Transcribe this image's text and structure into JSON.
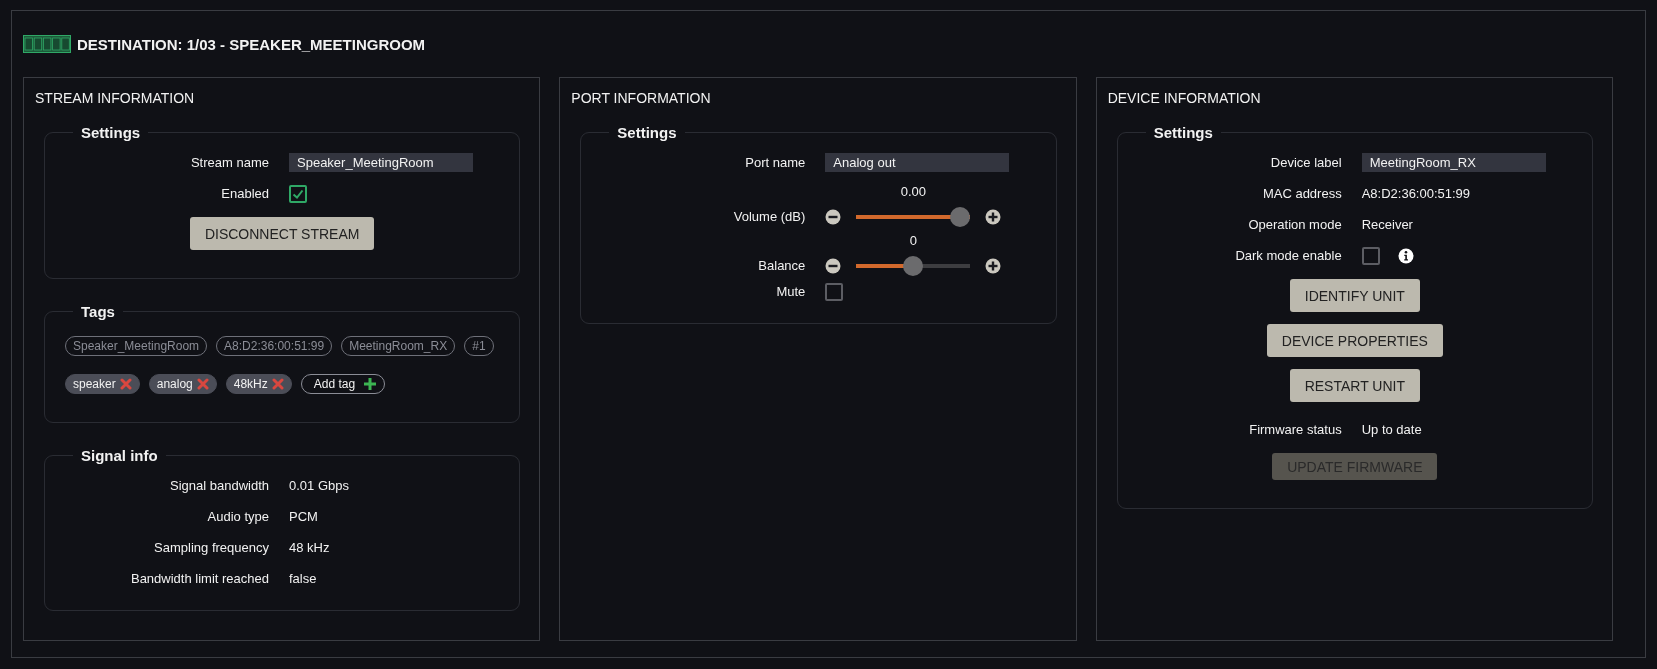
{
  "header": {
    "title": "DESTINATION: 1/03 - SPEAKER_MEETINGROOM"
  },
  "panels": [
    {
      "title": "STREAM INFORMATION",
      "groups": [
        {
          "title": "Settings",
          "kind": "form",
          "rows": [
            {
              "kind": "input",
              "label": "Stream name",
              "value": "Speaker_MeetingRoom"
            },
            {
              "kind": "checkbox",
              "label": "Enabled",
              "checked": true
            },
            {
              "kind": "button",
              "label": "DISCONNECT STREAM",
              "disabled": false
            }
          ]
        },
        {
          "title": "Tags",
          "kind": "tags",
          "tags": [
            {
              "label": "Speaker_MeetingRoom",
              "removable": false
            },
            {
              "label": "A8:D2:36:00:51:99",
              "removable": false
            },
            {
              "label": "MeetingRoom_RX",
              "removable": false
            },
            {
              "label": "#1",
              "removable": false
            },
            {
              "label": "speaker",
              "removable": true
            },
            {
              "label": "analog",
              "removable": true
            },
            {
              "label": "48kHz",
              "removable": true
            }
          ],
          "add_tag": "Add tag"
        },
        {
          "title": "Signal info",
          "kind": "form",
          "rows": [
            {
              "kind": "text",
              "label": "Signal bandwidth",
              "value": "0.01 Gbps"
            },
            {
              "kind": "text",
              "label": "Audio type",
              "value": "PCM"
            },
            {
              "kind": "text",
              "label": "Sampling frequency",
              "value": "48 kHz"
            },
            {
              "kind": "text",
              "label": "Bandwidth limit reached",
              "value": "false"
            }
          ]
        }
      ]
    },
    {
      "title": "PORT INFORMATION",
      "groups": [
        {
          "title": "Settings",
          "kind": "form",
          "rows": [
            {
              "kind": "input",
              "label": "Port name",
              "value": "Analog out"
            },
            {
              "kind": "slider",
              "label": "Volume (dB)",
              "reading": "0.00",
              "level": 1
            },
            {
              "kind": "slider",
              "label": "Balance",
              "reading": "0",
              "level": 0.5
            },
            {
              "kind": "checkbox",
              "label": "Mute",
              "checked": false
            }
          ]
        }
      ]
    },
    {
      "title": "DEVICE INFORMATION",
      "groups": [
        {
          "title": "Settings",
          "kind": "form",
          "rows": [
            {
              "kind": "input",
              "label": "Device label",
              "value": "MeetingRoom_RX"
            },
            {
              "kind": "text",
              "label": "MAC address",
              "value": "A8:D2:36:00:51:99"
            },
            {
              "kind": "text",
              "label": "Operation mode",
              "value": "Receiver"
            },
            {
              "kind": "checkbox",
              "label": "Dark mode enable",
              "checked": false,
              "info": true
            },
            {
              "kind": "button",
              "label": "IDENTIFY UNIT",
              "disabled": false
            },
            {
              "kind": "button",
              "label": "DEVICE PROPERTIES",
              "disabled": false
            },
            {
              "kind": "button",
              "label": "RESTART UNIT",
              "disabled": false
            },
            {
              "kind": "text",
              "label": "Firmware status",
              "value": "Up to date"
            },
            {
              "kind": "button",
              "label": "UPDATE FIRMWARE",
              "disabled": true
            }
          ]
        }
      ]
    }
  ]
}
